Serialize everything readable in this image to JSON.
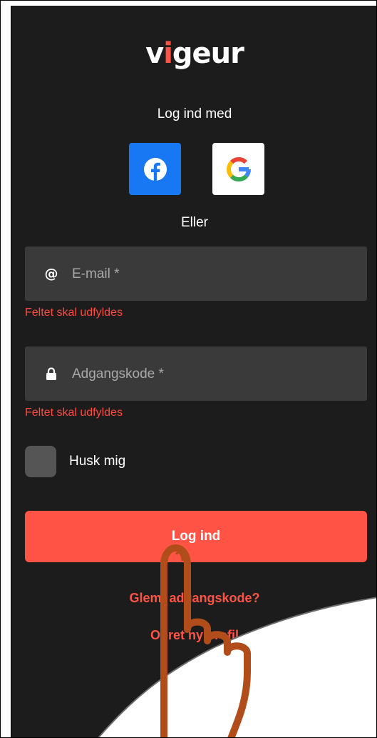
{
  "logo": {
    "prefix": "v",
    "accent": "i",
    "suffix": "geur"
  },
  "login_with": "Log ind med",
  "social": {
    "facebook_icon": "facebook-icon",
    "google_icon": "google-icon"
  },
  "or_label": "Eller",
  "email": {
    "placeholder": "E-mail *",
    "value": "",
    "error": "Feltet skal udfyldes",
    "icon": "at-icon"
  },
  "password": {
    "placeholder": "Adgangskode *",
    "value": "",
    "error": "Feltet skal udfyldes",
    "icon": "lock-icon"
  },
  "remember": {
    "label": "Husk mig",
    "checked": false
  },
  "login_button": "Log ind",
  "forgot_link": "Glemt adgangskode?",
  "create_link": "Opret ny profil",
  "colors": {
    "accent": "#ff5346",
    "panel": "#1c1c1c",
    "field": "#3a3a3a",
    "error": "#ff4a3d",
    "hand": "#b04d1a"
  }
}
